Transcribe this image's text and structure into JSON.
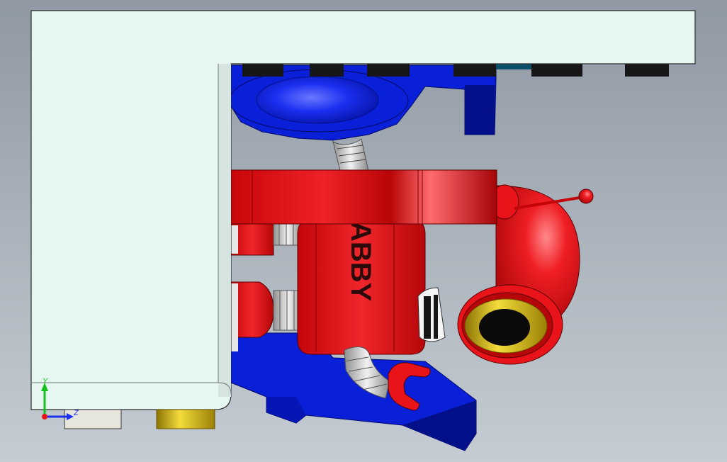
{
  "viewport": {
    "background_top": "#8f98a3",
    "background_bottom": "#c5ccd3"
  },
  "colors": {
    "panel": "#e6f7f1",
    "panel_shadow": "#b9c9c4",
    "robot_red": "#e8141a",
    "robot_red_dark": "#9c0a0c",
    "base_blue": "#0a1fd8",
    "base_blue_dark": "#03108a",
    "gold": "#e2c31a",
    "metal": "#c9c9c9",
    "black": "#161616"
  },
  "robot": {
    "chest_text": "ABBY"
  },
  "triad": {
    "y_label": "Y",
    "z_label": "Z",
    "icon": "coordinate-triad-icon"
  }
}
